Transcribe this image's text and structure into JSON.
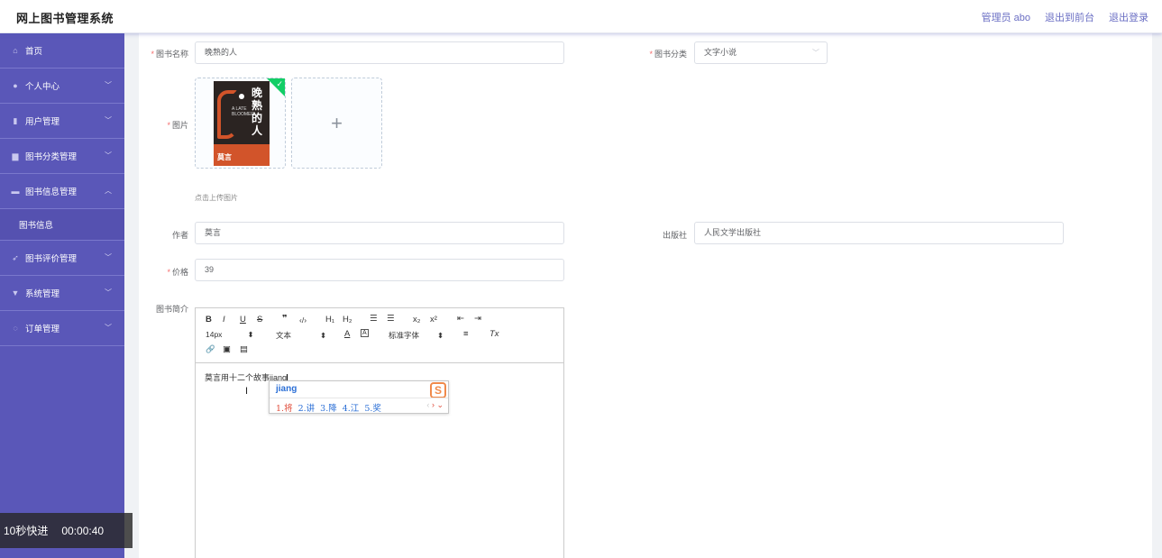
{
  "header": {
    "brand": "网上图书管理系统",
    "admin": "管理员 abo",
    "exit_front": "退出到前台",
    "logout": "退出登录"
  },
  "sidebar": {
    "items": [
      {
        "label": "首页",
        "icon": "home-icon"
      },
      {
        "label": "个人中心",
        "icon": "user-icon"
      },
      {
        "label": "用户管理",
        "icon": "chart-icon"
      },
      {
        "label": "图书分类管理",
        "icon": "folder-icon"
      },
      {
        "label": "图书信息管理",
        "icon": "book-icon",
        "expanded": true
      },
      {
        "label": "图书信息",
        "sub": true
      },
      {
        "label": "图书评价管理",
        "icon": "send-icon"
      },
      {
        "label": "系统管理",
        "icon": "monitor-icon"
      },
      {
        "label": "订单管理",
        "icon": "clock-icon"
      }
    ]
  },
  "form": {
    "book_name_label": "图书名称",
    "book_name_value": "晚熟的人",
    "category_label": "图书分类",
    "category_value": "文字小说",
    "image_label": "图片",
    "upload_hint": "点击上传图片",
    "book_cover_title": "晚熟的人",
    "book_cover_subtitle": "A LATE BLOOMER",
    "book_cover_author": "莫言",
    "author_label": "作者",
    "author_value": "莫言",
    "publisher_label": "出版社",
    "publisher_value": "人民文学出版社",
    "price_label": "价格",
    "price_value": "39",
    "intro_label": "图书简介"
  },
  "editor": {
    "toolbar": {
      "bold": "B",
      "italic": "I",
      "underline": "U",
      "strike": "S",
      "quote": "❞",
      "code": "‹/›",
      "h1": "H₁",
      "h2": "H₂",
      "ol": "☰",
      "ul": "☰",
      "sub": "x₂",
      "sup": "x²",
      "outdent": "⇤",
      "indent": "⇥",
      "size": "14px",
      "header": "文本",
      "color": "A",
      "bg": "A",
      "font": "标准字体",
      "align": "≡",
      "clean": "Tx",
      "link": "🔗",
      "image": "▣",
      "video": "▤"
    },
    "content": "莫言用十二个故事jiang"
  },
  "ime": {
    "composition": "jiang",
    "candidates": [
      "1.将",
      "2.讲",
      "3.降",
      "4.江",
      "5.奖"
    ],
    "logo": "S"
  },
  "video": {
    "skip_label": "10秒快进",
    "time": "00:00:40"
  }
}
